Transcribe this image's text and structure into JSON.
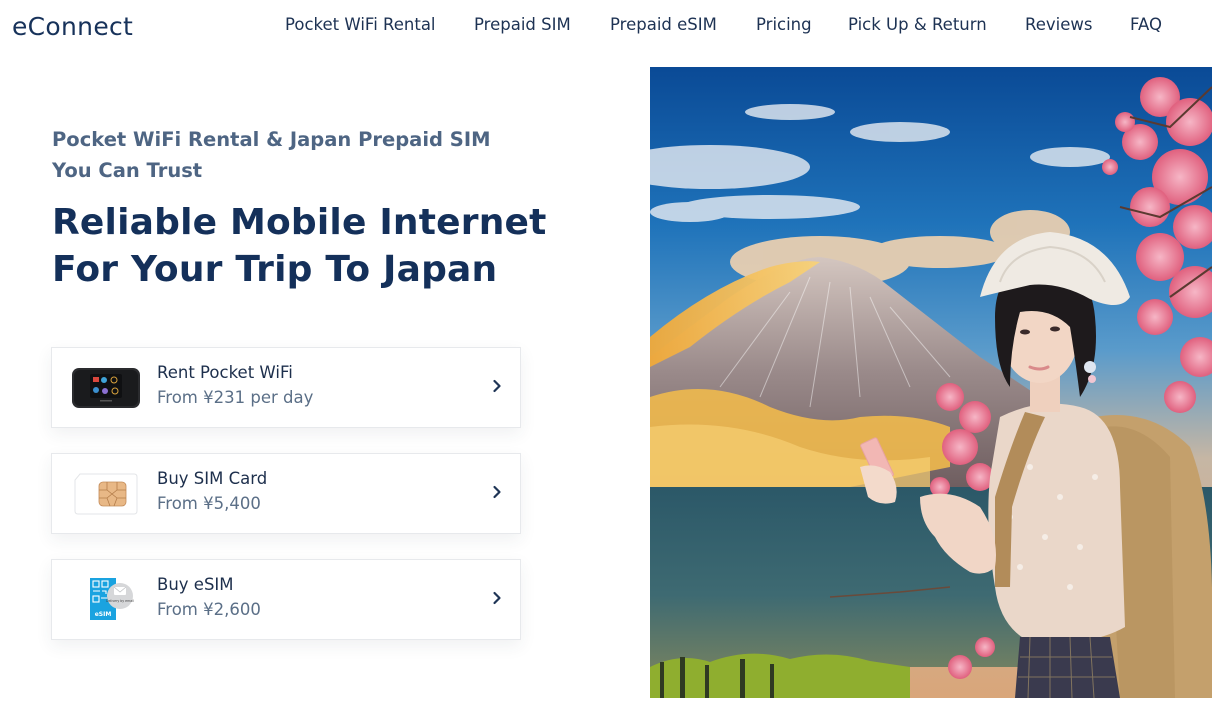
{
  "header": {
    "logo_text": "eConnect",
    "nav": [
      {
        "label": "Pocket WiFi Rental"
      },
      {
        "label": "Prepaid SIM"
      },
      {
        "label": "Prepaid eSIM"
      },
      {
        "label": "Pricing"
      },
      {
        "label": "Pick Up & Return"
      },
      {
        "label": "Reviews"
      },
      {
        "label": "FAQ"
      }
    ]
  },
  "hero": {
    "kicker_line1": "Pocket WiFi Rental & Japan Prepaid SIM",
    "kicker_line2": "You Can Trust",
    "headline_line1": "Reliable Mobile Internet",
    "headline_line2": "For Your Trip To Japan",
    "image_alt": "Woman traveler with backpack holding phone in front of Mount Fuji and cherry blossoms"
  },
  "products": [
    {
      "title": "Rent Pocket WiFi",
      "subtitle": "From ¥231 per day",
      "icon": "pocket-wifi-device-icon"
    },
    {
      "title": "Buy SIM Card",
      "subtitle": "From ¥5,400",
      "icon": "sim-card-icon"
    },
    {
      "title": "Buy eSIM",
      "subtitle": "From ¥2,600",
      "icon": "esim-icon",
      "badge_text": "eSIM",
      "badge_note": "Delivery by email"
    }
  ],
  "colors": {
    "brand_navy": "#14305a",
    "kicker_gray_blue": "#4e6583",
    "subtitle_gray": "#5b6f87",
    "esim_blue": "#1aa3e0"
  }
}
